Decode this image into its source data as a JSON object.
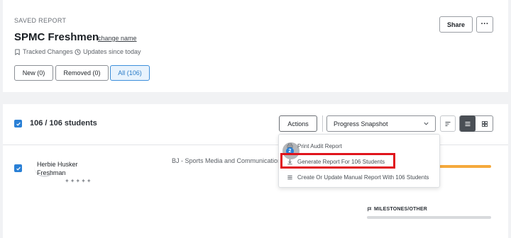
{
  "header": {
    "eyebrow": "SAVED REPORT",
    "title": "SPMC Freshmen",
    "change_name_link": "change name",
    "tracked_changes": "Tracked Changes",
    "updates_since": "Updates since today",
    "share_label": "Share",
    "more_label": "···"
  },
  "filters": [
    {
      "label": "New (0)",
      "active": false
    },
    {
      "label": "Removed (0)",
      "active": false
    },
    {
      "label": "All (106)",
      "active": true
    }
  ],
  "toolbar": {
    "count_label": "106 / 106 students",
    "actions_label": "Actions",
    "view_select": "Progress Snapshot"
  },
  "actions_menu": {
    "items": [
      {
        "label": "Print Audit Report",
        "icon": "printer-icon"
      },
      {
        "label": "Generate Report For 106 Students",
        "icon": "download-icon"
      },
      {
        "label": "Create Or Update Manual Report With 106 Students",
        "icon": "list-icon"
      }
    ]
  },
  "student": {
    "name_line1": "Herbie Husker",
    "name_line2": "Freshman",
    "rating": "✦✦✦✦✦",
    "major": "BJ - Sports Media and Communication",
    "milestones_label": "MILESTONES/OTHER"
  },
  "cursor_marker": "2",
  "colors": {
    "accent": "#2a80d6",
    "progress_orange": "#f5a93c",
    "highlight_red": "#e0141c"
  }
}
